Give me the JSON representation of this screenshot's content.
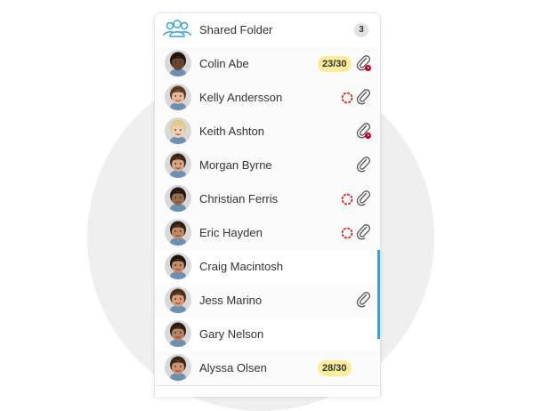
{
  "folder": {
    "name": "Shared Folder",
    "count": "3",
    "icon": "people-icon"
  },
  "students": [
    {
      "name": "Colin Abe",
      "score": "23/30",
      "progress": false,
      "attachment": "attachment-late",
      "skin": "#6a4530",
      "hair": "#1e140e"
    },
    {
      "name": "Kelly Andersson",
      "score": "",
      "progress": true,
      "attachment": "attachment",
      "skin": "#e7b998",
      "hair": "#5b3820"
    },
    {
      "name": "Keith Ashton",
      "score": "",
      "progress": false,
      "attachment": "attachment-late",
      "skin": "#f0cfb4",
      "hair": "#e1c98a"
    },
    {
      "name": "Morgan Byrne",
      "score": "",
      "progress": false,
      "attachment": "attachment",
      "skin": "#d7a283",
      "hair": "#3c2416"
    },
    {
      "name": "Christian Ferris",
      "score": "",
      "progress": true,
      "attachment": "attachment",
      "skin": "#9a6a4c",
      "hair": "#231710"
    },
    {
      "name": "Eric Hayden",
      "score": "",
      "progress": true,
      "attachment": "attachment",
      "skin": "#c28863",
      "hair": "#2c1d12"
    },
    {
      "name": "Craig Macintosh",
      "score": "",
      "progress": false,
      "attachment": "",
      "skin": "#c58b67",
      "hair": "#1c130d"
    },
    {
      "name": "Jess Marino",
      "score": "",
      "progress": false,
      "attachment": "attachment",
      "skin": "#d89a78",
      "hair": "#4a2d1b"
    },
    {
      "name": "Gary Nelson",
      "score": "",
      "progress": false,
      "attachment": "",
      "skin": "#b98160",
      "hair": "#2a1a10"
    },
    {
      "name": "Alyssa Olsen",
      "score": "28/30",
      "progress": false,
      "attachment": "",
      "skin": "#cf9572",
      "hair": "#3a2416"
    }
  ],
  "colors": {
    "accent": "#2da5dc",
    "score_badge": "#fbec9c",
    "progress_ring": "#e2231a",
    "late_dot": "#d0021b"
  }
}
